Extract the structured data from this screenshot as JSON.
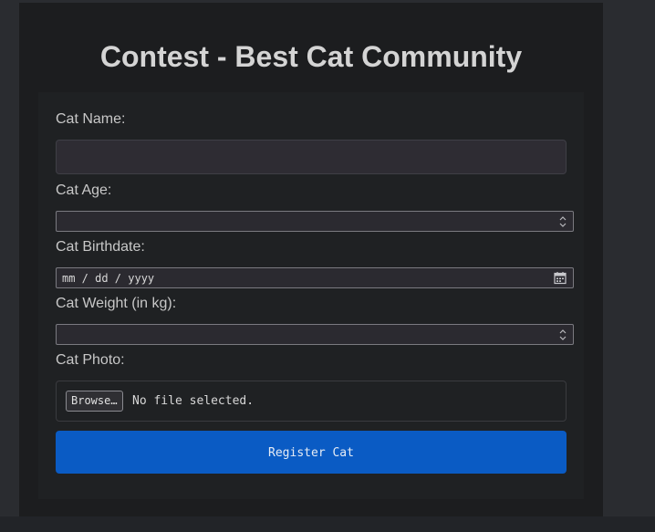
{
  "page": {
    "title": "Contest - Best Cat Community"
  },
  "form": {
    "cat_name": {
      "label": "Cat Name:",
      "value": ""
    },
    "cat_age": {
      "label": "Cat Age:",
      "value": ""
    },
    "cat_birthdate": {
      "label": "Cat Birthdate:",
      "placeholder": "mm / dd / yyyy"
    },
    "cat_weight": {
      "label": "Cat Weight (in kg):",
      "value": ""
    },
    "cat_photo": {
      "label": "Cat Photo:",
      "browse_label": "Browse…",
      "status": "No file selected."
    },
    "submit_label": "Register Cat"
  },
  "icons": {
    "age_spinner": "spinner-arrows-icon",
    "weight_spinner": "spinner-arrows-icon",
    "date_picker": "calendar-icon"
  },
  "colors": {
    "submit_button": "#0a5bc4",
    "card_background": "#1c1d1f",
    "page_background": "#2a2c30"
  }
}
